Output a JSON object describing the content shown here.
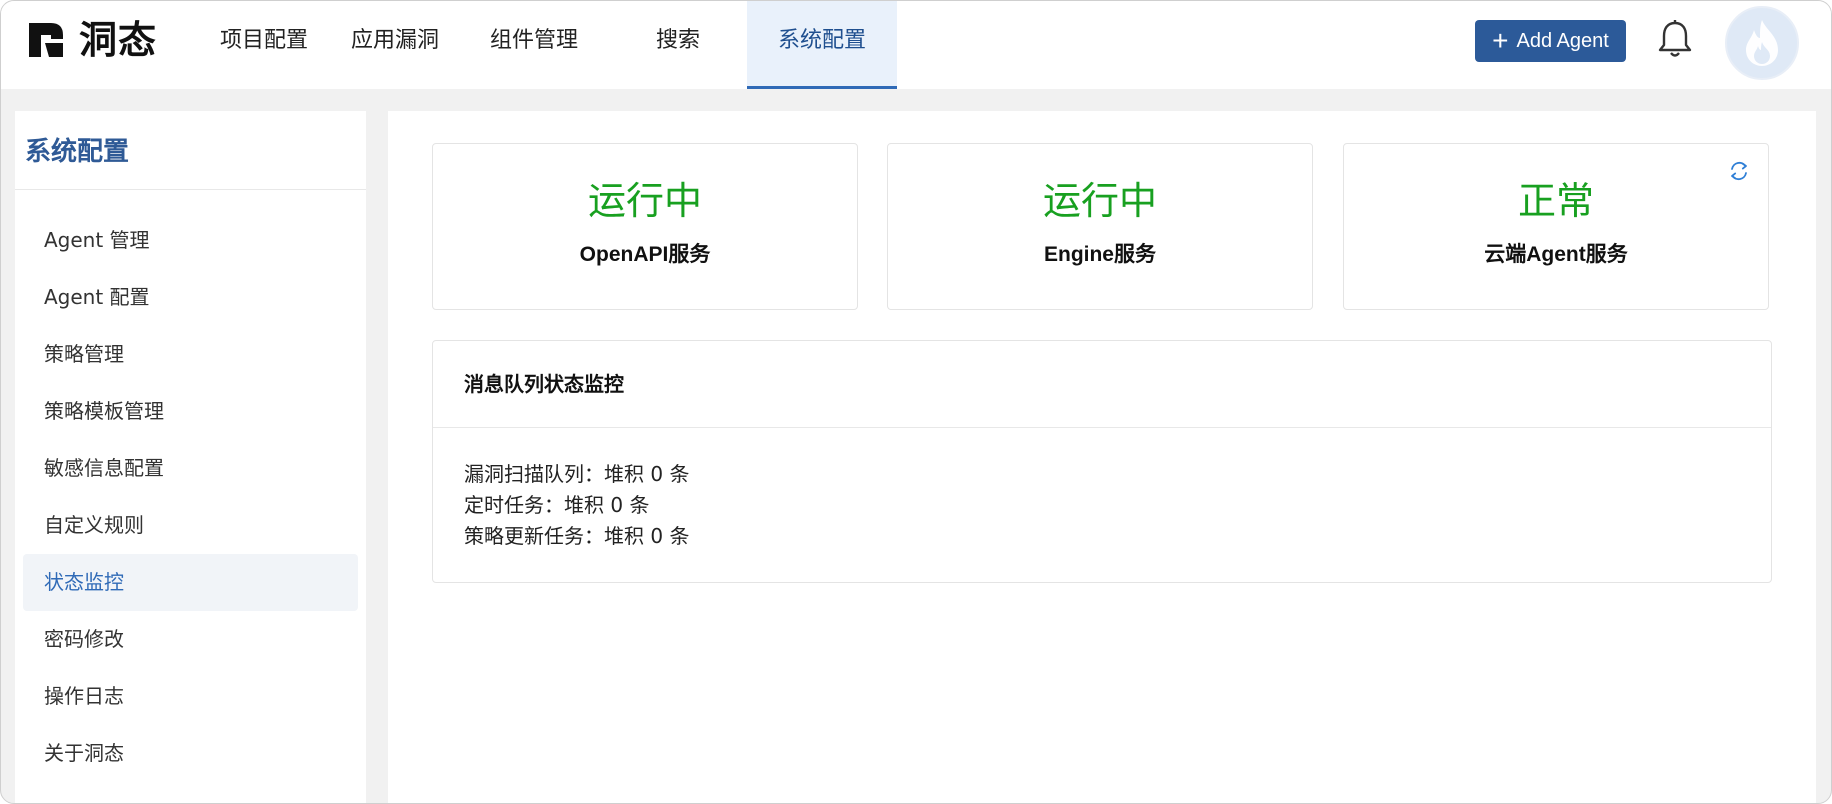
{
  "brand": {
    "name": "洞态"
  },
  "nav": {
    "items": [
      {
        "label": "项目配置"
      },
      {
        "label": "应用漏洞"
      },
      {
        "label": "组件管理"
      },
      {
        "label": "搜索"
      },
      {
        "label": "系统配置"
      }
    ],
    "active_index": 4,
    "add_agent_label": "Add Agent"
  },
  "sidebar": {
    "title": "系统配置",
    "items": [
      {
        "label": "Agent 管理"
      },
      {
        "label": "Agent 配置"
      },
      {
        "label": "策略管理"
      },
      {
        "label": "策略模板管理"
      },
      {
        "label": "敏感信息配置"
      },
      {
        "label": "自定义规则"
      },
      {
        "label": "状态监控"
      },
      {
        "label": "密码修改"
      },
      {
        "label": "操作日志"
      },
      {
        "label": "关于洞态"
      }
    ],
    "active_index": 6
  },
  "services": [
    {
      "status": "运行中",
      "name": "OpenAPI服务"
    },
    {
      "status": "运行中",
      "name": "Engine服务"
    },
    {
      "status": "正常",
      "name": "云端Agent服务"
    }
  ],
  "message_queue": {
    "title": "消息队列状态监控",
    "lines": [
      "漏洞扫描队列：堆积 0 条",
      "定时任务：堆积 0 条",
      "策略更新任务：堆积 0 条"
    ]
  },
  "colors": {
    "accent": "#2c5a99",
    "status_ok": "#18a020",
    "active_text": "#2f6ab7"
  },
  "icons": [
    "logo-mark-icon",
    "plus-icon",
    "bell-icon",
    "flame-avatar-icon",
    "refresh-icon"
  ]
}
